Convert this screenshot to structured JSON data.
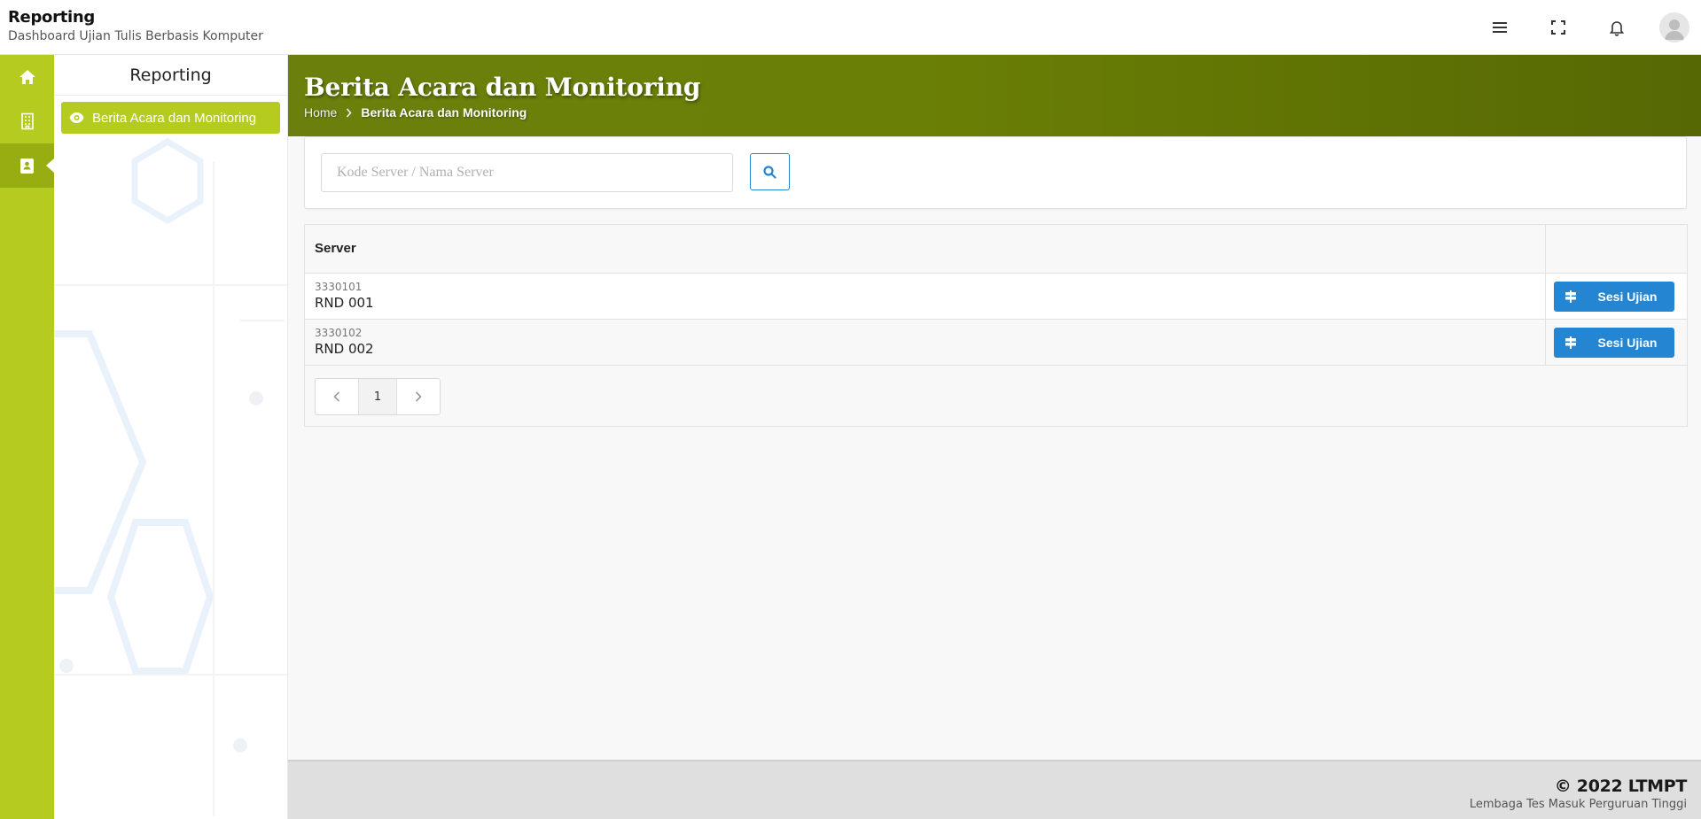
{
  "header": {
    "title": "Reporting",
    "subtitle": "Dashboard Ujian Tulis Berbasis Komputer",
    "icons": [
      "menu-icon",
      "fullscreen-icon",
      "bell-icon",
      "user-avatar-icon"
    ]
  },
  "rail": {
    "items": [
      {
        "icon": "home-icon"
      },
      {
        "icon": "building-icon"
      },
      {
        "icon": "address-book-icon",
        "active": true
      }
    ]
  },
  "sidebar": {
    "title": "Reporting",
    "items": [
      {
        "label": "Berita Acara dan Monitoring",
        "icon": "eye-icon",
        "active": true
      }
    ]
  },
  "page": {
    "title": "Berita Acara dan Monitoring",
    "breadcrumb": {
      "home": "Home",
      "current": "Berita Acara dan Monitoring"
    }
  },
  "search": {
    "placeholder": "Kode Server / Nama Server",
    "value": ""
  },
  "table": {
    "headers": [
      "Server",
      ""
    ],
    "rows": [
      {
        "code": "3330101",
        "name": "RND 001",
        "action": "Sesi Ujian"
      },
      {
        "code": "3330102",
        "name": "RND 002",
        "action": "Sesi Ujian"
      }
    ]
  },
  "pagination": {
    "current_page": "1"
  },
  "footer": {
    "copyright": "© 2022 LTMPT",
    "organization": "Lembaga Tes Masuk Perguruan Tinggi"
  },
  "colors": {
    "accent_green": "#b5cb1f",
    "banner_olive": "#6a7f05",
    "primary_blue": "#2486d2"
  }
}
